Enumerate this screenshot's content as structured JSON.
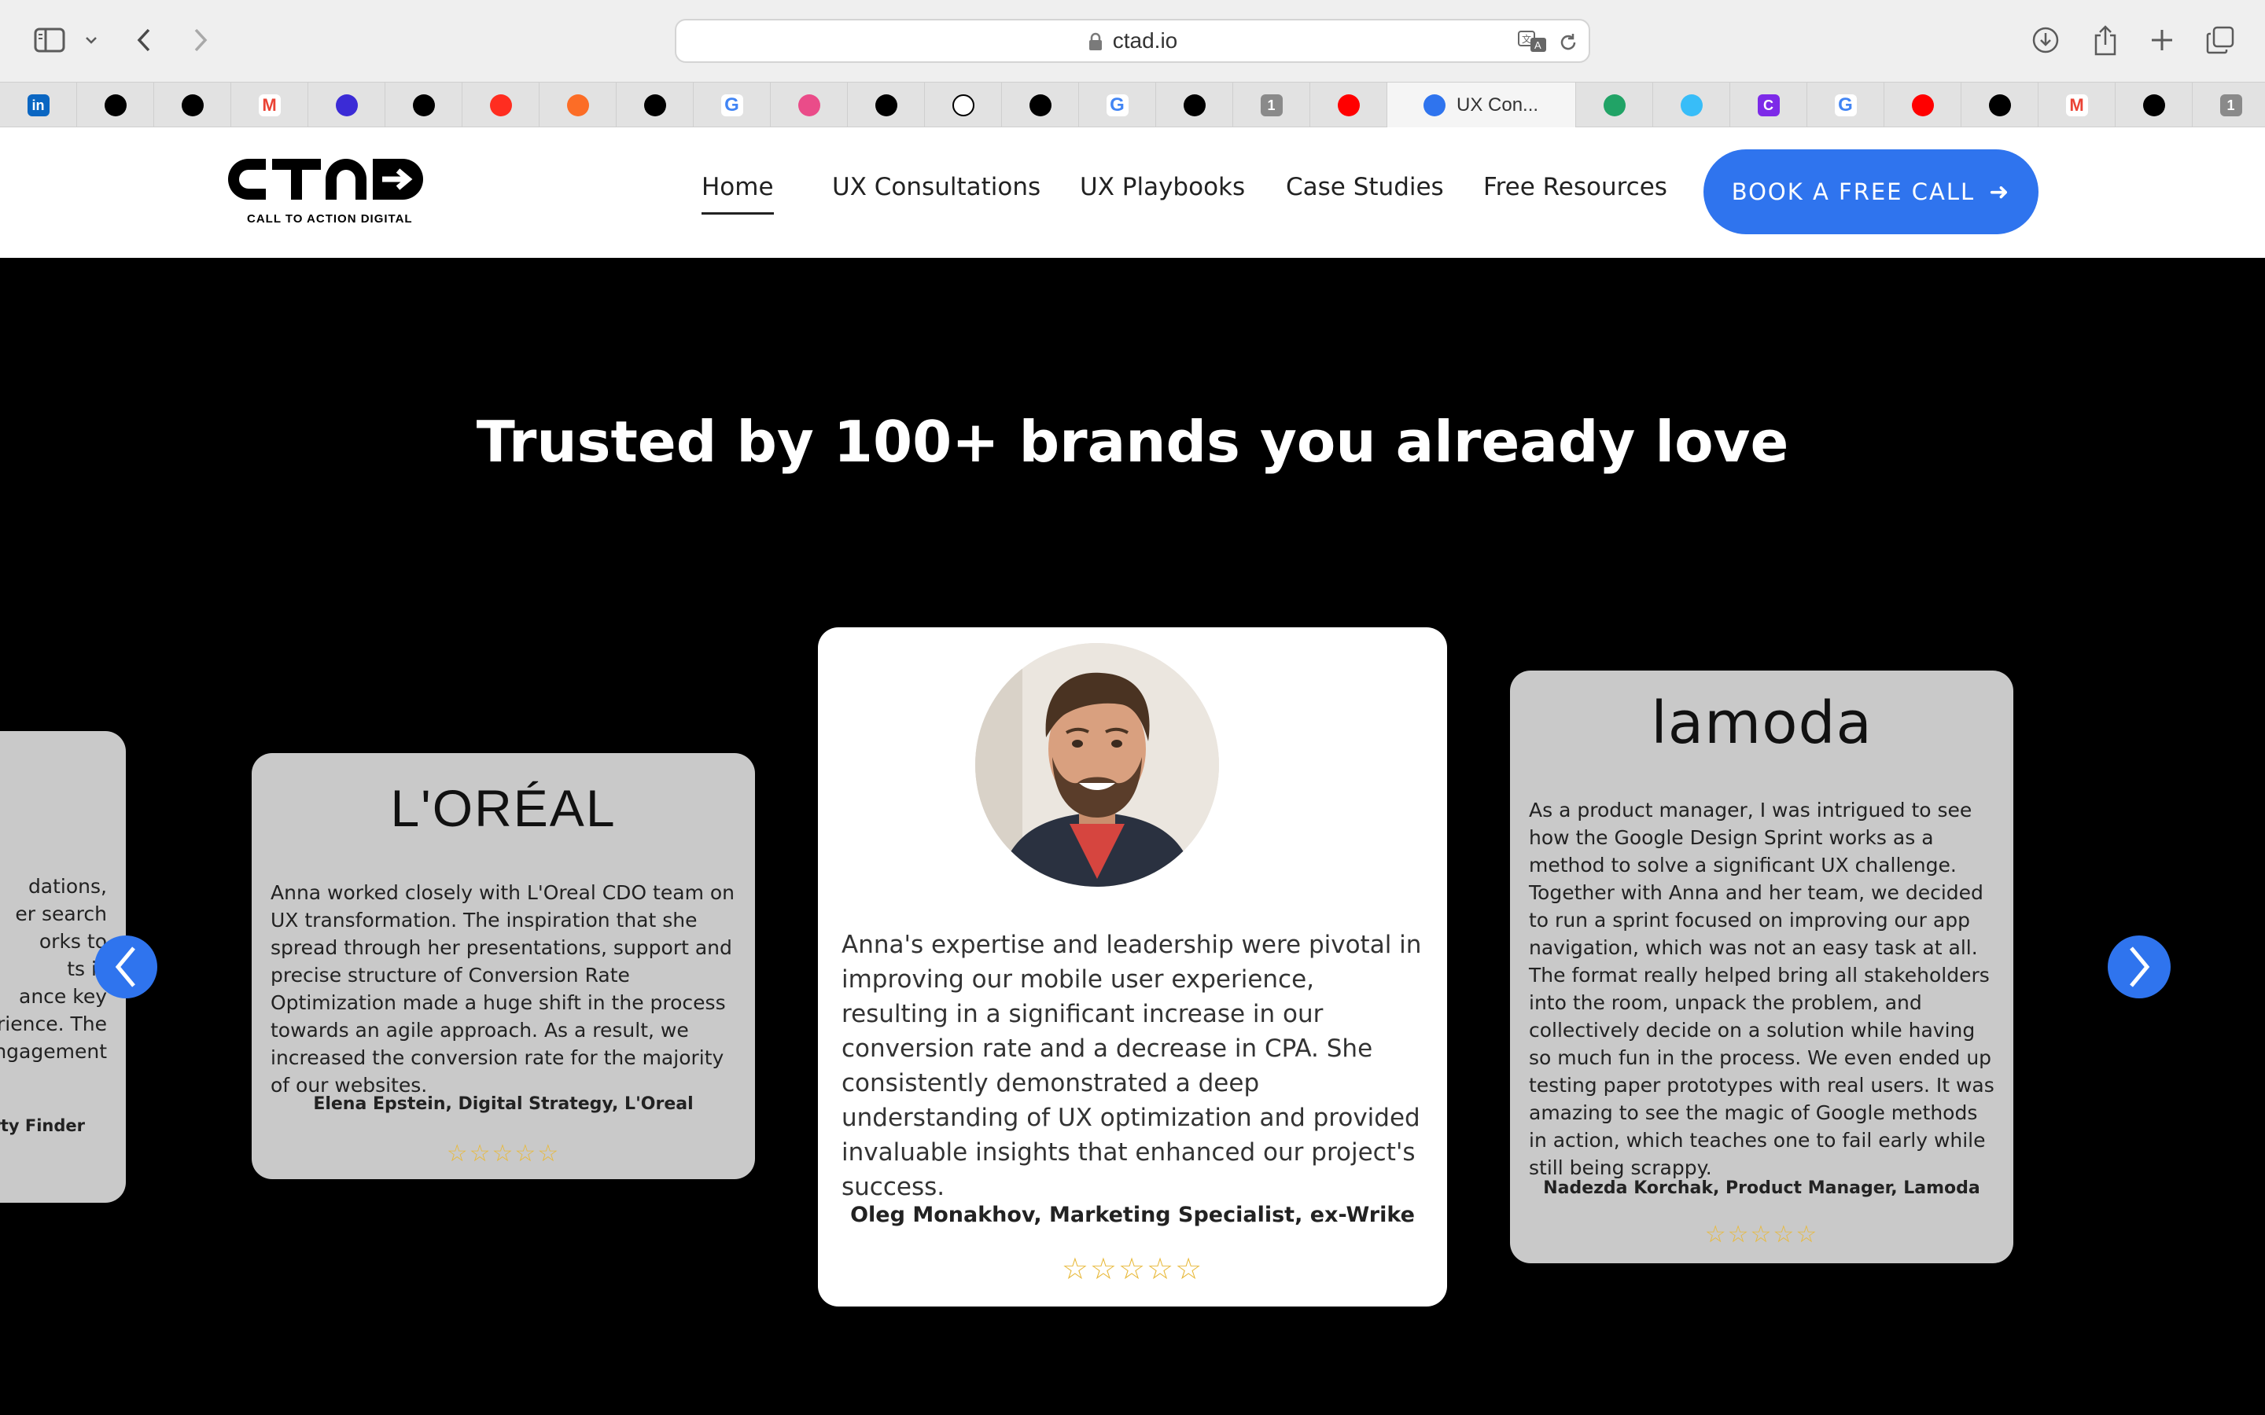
{
  "browser": {
    "url": "ctad.io",
    "active_tab_title": "UX Con...",
    "tabs": [
      {
        "icon": "linkedin-icon",
        "color": "#0a66c2",
        "glyph": "in"
      },
      {
        "icon": "github-icon",
        "color": "#000000",
        "glyph": ""
      },
      {
        "icon": "site-icon",
        "color": "#000000",
        "glyph": ""
      },
      {
        "icon": "gmail-icon",
        "color": "#ea4335",
        "glyph": "M"
      },
      {
        "icon": "app-icon",
        "color": "#3b2bd6",
        "glyph": ""
      },
      {
        "icon": "site-icon",
        "color": "#000000",
        "glyph": ""
      },
      {
        "icon": "laravel-icon",
        "color": "#ff2d20",
        "glyph": ""
      },
      {
        "icon": "gitlab-icon",
        "color": "#fc6d26",
        "glyph": ""
      },
      {
        "icon": "bot-icon",
        "color": "#000000",
        "glyph": ""
      },
      {
        "icon": "google-icon",
        "color": "#4285f4",
        "glyph": "G"
      },
      {
        "icon": "dribbble-icon",
        "color": "#ea4c89",
        "glyph": ""
      },
      {
        "icon": "chatgpt-icon",
        "color": "#000000",
        "glyph": ""
      },
      {
        "icon": "chatgpt-icon",
        "color": "#ffffff",
        "glyph": ""
      },
      {
        "icon": "chatgpt-icon",
        "color": "#000000",
        "glyph": ""
      },
      {
        "icon": "google-icon",
        "color": "#4285f4",
        "glyph": "G"
      },
      {
        "icon": "github-icon",
        "color": "#000000",
        "glyph": ""
      },
      {
        "icon": "onepassword-icon",
        "color": "#8a8a8a",
        "glyph": "1"
      },
      {
        "icon": "youtube-icon",
        "color": "#ff0000",
        "glyph": ""
      },
      {
        "icon": "ctad-icon",
        "color": "#2f74ee",
        "glyph": "",
        "active": true
      },
      {
        "icon": "layers-icon",
        "color": "#21a366",
        "glyph": ""
      },
      {
        "icon": "tailwind-icon",
        "color": "#38bdf8",
        "glyph": ""
      },
      {
        "icon": "canva-icon",
        "color": "#7d2ae8",
        "glyph": "C"
      },
      {
        "icon": "google-icon",
        "color": "#4285f4",
        "glyph": "G"
      },
      {
        "icon": "youtube-icon",
        "color": "#ff0000",
        "glyph": ""
      },
      {
        "icon": "github-icon",
        "color": "#000000",
        "glyph": ""
      },
      {
        "icon": "gmail-icon",
        "color": "#ea4335",
        "glyph": "M"
      },
      {
        "icon": "target-icon",
        "color": "#000000",
        "glyph": ""
      },
      {
        "icon": "onepassword-icon",
        "color": "#8a8a8a",
        "glyph": "1"
      }
    ]
  },
  "site": {
    "logo_text": "CTAD",
    "logo_tagline": "CALL TO ACTION DIGITAL",
    "nav": {
      "home": "Home",
      "ux_consultations": "UX Consultations",
      "ux_playbooks": "UX Playbooks",
      "case_studies": "Case Studies",
      "free_resources": "Free Resources"
    },
    "cta": {
      "label": "BOOK A FREE CALL",
      "arrow": "➜"
    },
    "accent_color": "#2f74ee"
  },
  "hero": {
    "heading": "Trusted by 100+ brands you already love"
  },
  "testimonials": {
    "partial_left": {
      "lines": [
        "dations,",
        "er search",
        "orks to",
        "ts is",
        "ance key",
        "erience. The",
        "engagement"
      ],
      "author": "erty Finder"
    },
    "loreal": {
      "brand": "L'ORÉAL",
      "quote": "Anna worked closely with L'Oreal CDO team on UX transformation. The inspiration that she spread through her presentations, support and precise structure of Conversion Rate Optimization made a huge shift in the process towards an agile approach. As a result, we increased the conversion rate for the majority of our websites.",
      "author": "Elena Epstein, Digital Strategy, L'Oreal",
      "rating": 5,
      "stars": "☆☆☆☆☆"
    },
    "wrike": {
      "quote": "Anna's expertise and leadership were pivotal in improving our mobile user experience, resulting in a significant increase in our conversion rate and a decrease in CPA. She consistently demonstrated a deep understanding of UX optimization and provided invaluable insights that enhanced our project's success.",
      "author": "Oleg Monakhov, Marketing Specialist, ex-Wrike",
      "rating": 5,
      "stars": "☆☆☆☆☆"
    },
    "lamoda": {
      "brand": "lamoda",
      "quote": "As a product manager, I was intrigued to see how the Google Design Sprint works as a method to solve a significant UX challenge. Together with Anna and her team, we decided to run a sprint focused on improving our app navigation, which was not an easy task at all. The format really helped bring all stakeholders into the room, unpack the problem, and collectively decide on a solution while having so much fun in the process. We even ended up testing paper prototypes with real users. It was amazing to see the magic of Google methods in action, which teaches one to fail early while still being scrappy.",
      "author": "Nadezda Korchak, Product Manager, Lamoda",
      "rating": 5,
      "stars": "☆☆☆☆☆"
    }
  }
}
